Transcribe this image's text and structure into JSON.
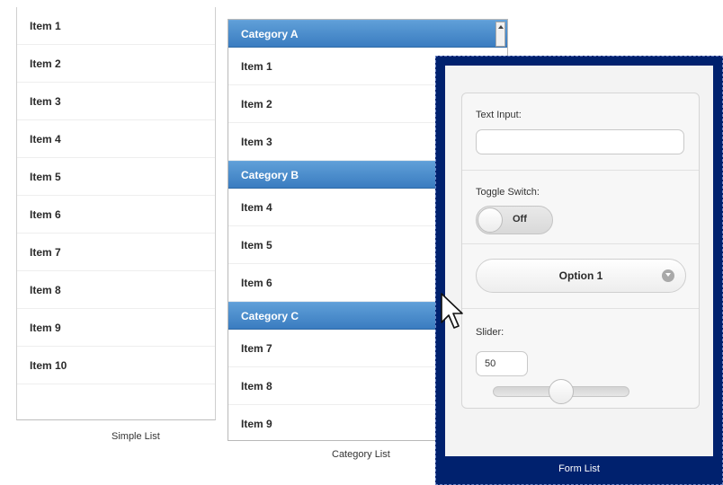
{
  "simple_list": {
    "items": [
      "Item 1",
      "Item 2",
      "Item 3",
      "Item 4",
      "Item 5",
      "Item 6",
      "Item 7",
      "Item 8",
      "Item 9",
      "Item 10"
    ],
    "caption": "Simple List"
  },
  "category_list": {
    "categories": [
      {
        "name": "Category A",
        "items": [
          "Item 1",
          "Item 2",
          "Item 3"
        ]
      },
      {
        "name": "Category B",
        "items": [
          "Item 4",
          "Item 5",
          "Item 6"
        ]
      },
      {
        "name": "Category C",
        "items": [
          "Item 7",
          "Item 8",
          "Item 9"
        ]
      }
    ],
    "caption": "Category List"
  },
  "form_list": {
    "text_input_label": "Text Input:",
    "text_input_value": "",
    "toggle_label": "Toggle Switch:",
    "toggle_state": "Off",
    "select_value": "Option 1",
    "slider_label": "Slider:",
    "slider_value": "50",
    "slider_fraction": 0.5,
    "caption": "Form List"
  },
  "colors": {
    "category_header": "#3a7cc0",
    "form_panel_bg": "#00216e"
  }
}
